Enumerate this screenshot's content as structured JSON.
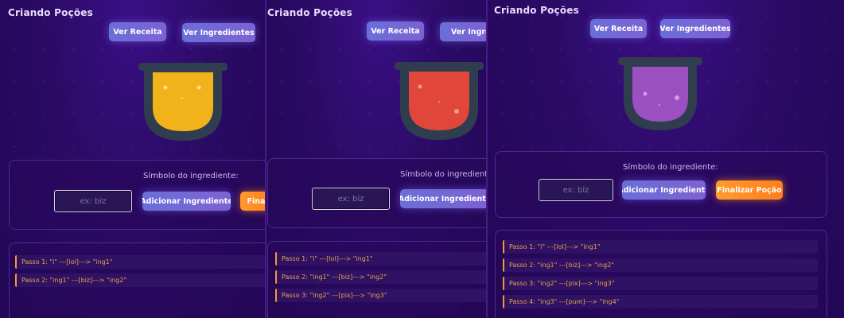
{
  "app": {
    "title": "Criando Poções"
  },
  "buttons": {
    "recipe": "Ver Receita",
    "ingredients": "Ver Ingredientes",
    "ingredients_cut": "Ver Ingredie",
    "add": "Adicionar Ingrediente",
    "finish": "Finalizar Poção",
    "finish_cut": "Fina"
  },
  "form": {
    "label": "Símbolo do ingrediente:",
    "placeholder": "ex: biz"
  },
  "potion_colors": {
    "panel1": "#f2b31a",
    "panel2": "#e0463a",
    "panel3": "#9b4fc0"
  },
  "steps": {
    "s1": "Passo 1: \"i\" ---[lol]---> \"ing1\"",
    "s2": "Passo 2: \"ing1\" ---[biz]---> \"ing2\"",
    "s3": "Passo 3: \"ing2\" ---[pix]---> \"ing3\"",
    "s4": "Passo 4: \"ing3\" ---[pum]---> \"ing4\""
  }
}
